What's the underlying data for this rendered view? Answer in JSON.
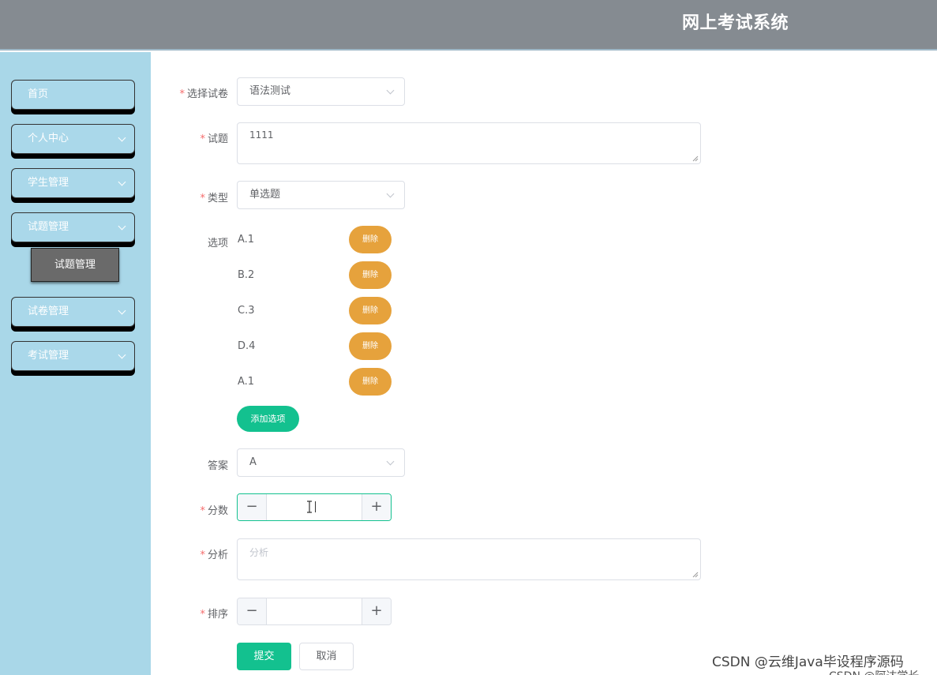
{
  "header": {
    "title": "网上考试系统"
  },
  "sidebar": {
    "items": [
      {
        "label": "首页"
      },
      {
        "label": "个人中心"
      },
      {
        "label": "学生管理"
      },
      {
        "label": "试题管理"
      },
      {
        "label": "试卷管理"
      },
      {
        "label": "考试管理"
      }
    ],
    "active_sub": "试题管理"
  },
  "form": {
    "paper": {
      "label": "选择试卷",
      "value": "语法测试"
    },
    "question": {
      "label": "试题",
      "value": "1111"
    },
    "type": {
      "label": "类型",
      "value": "单选题"
    },
    "options_label": "选项",
    "options": [
      "A.1",
      "B.2",
      "C.3",
      "D.4",
      "A.1"
    ],
    "delete_label": "删除",
    "add_option_label": "添加选项",
    "answer": {
      "label": "答案",
      "value": "A"
    },
    "score": {
      "label": "分数",
      "value": "",
      "minus": "−",
      "plus": "+"
    },
    "analysis": {
      "label": "分析",
      "placeholder": "分析"
    },
    "sort": {
      "label": "排序",
      "value": "",
      "minus": "−",
      "plus": "+"
    },
    "submit_label": "提交",
    "cancel_label": "取消"
  },
  "watermark": "CSDN @云维Java毕设程序源码",
  "watermark2": "CSDN @阿达学长",
  "colors": {
    "header_bg": "#858b91",
    "sidebar_bg": "#a9d7e8",
    "primary": "#13c18f",
    "warning": "#e6a23c",
    "required": "#f56c6c"
  }
}
